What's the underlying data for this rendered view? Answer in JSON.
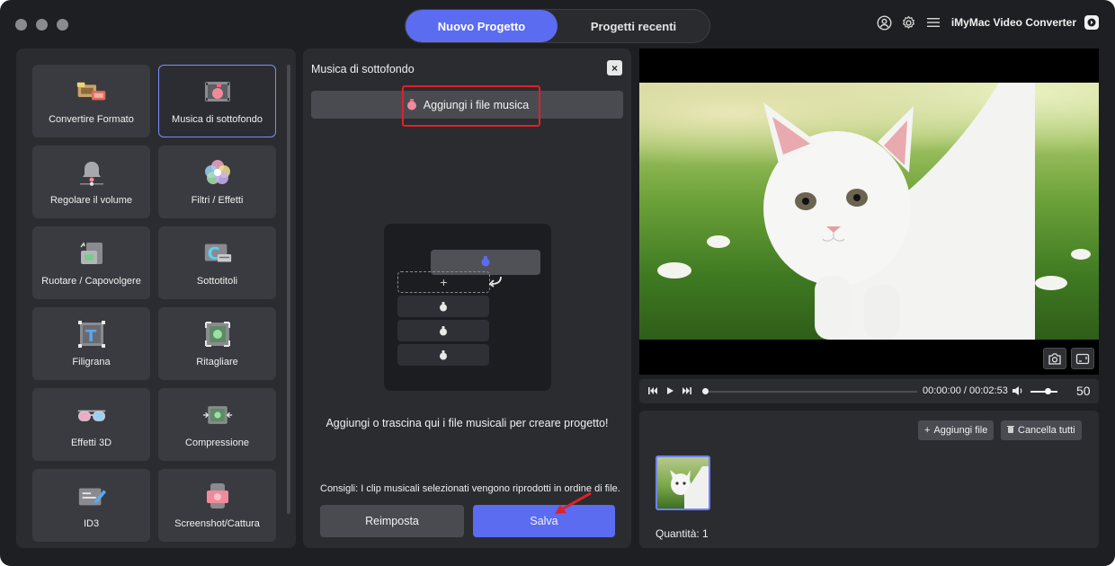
{
  "header": {
    "tabs": [
      {
        "label": "Nuovo Progetto",
        "active": true
      },
      {
        "label": "Progetti recenti",
        "active": false
      }
    ],
    "brand": "iMyMac Video Converter",
    "icons": [
      "user-icon",
      "gear-icon",
      "menu-icon",
      "logo-icon"
    ]
  },
  "tools": [
    {
      "label": "Convertire Formato",
      "icon": "convert-icon"
    },
    {
      "label": "Musica di sottofondo",
      "icon": "music-icon",
      "selected": true
    },
    {
      "label": "Regolare il volume",
      "icon": "volume-bell-icon"
    },
    {
      "label": "Filtri / Effetti",
      "icon": "filter-icon"
    },
    {
      "label": "Ruotare / Capovolgere",
      "icon": "rotate-icon"
    },
    {
      "label": "Sottotitoli",
      "icon": "subtitle-icon"
    },
    {
      "label": "Filigrana",
      "icon": "watermark-icon"
    },
    {
      "label": "Ritagliare",
      "icon": "crop-icon"
    },
    {
      "label": "Effetti 3D",
      "icon": "3d-glasses-icon"
    },
    {
      "label": "Compressione",
      "icon": "compress-icon"
    },
    {
      "label": "ID3",
      "icon": "id3-icon"
    },
    {
      "label": "Screenshot/Cattura",
      "icon": "screenshot-icon"
    }
  ],
  "music_panel": {
    "title": "Musica di sottofondo",
    "close": "×",
    "add_music_label": "Aggiungi i file musica",
    "illustration_plus": "+",
    "drop_text": "Aggiungi o trascina qui i file musicali per creare progetto!",
    "tip": "Consigli: I clip musicali selezionati vengono riprodotti in ordine di file.",
    "reset_label": "Reimposta",
    "save_label": "Salva"
  },
  "player": {
    "time": "00:00:00 / 00:02:53",
    "volume": "50",
    "progress": 0.0
  },
  "files": {
    "add_label": "Aggiungi file",
    "clear_label": "Cancella tutti",
    "quantity": "Quantità: 1"
  },
  "colors": {
    "accent": "#5b6cf0",
    "highlight": "#e0202a",
    "panel": "#2b2c30",
    "tile": "#3a3b40"
  }
}
